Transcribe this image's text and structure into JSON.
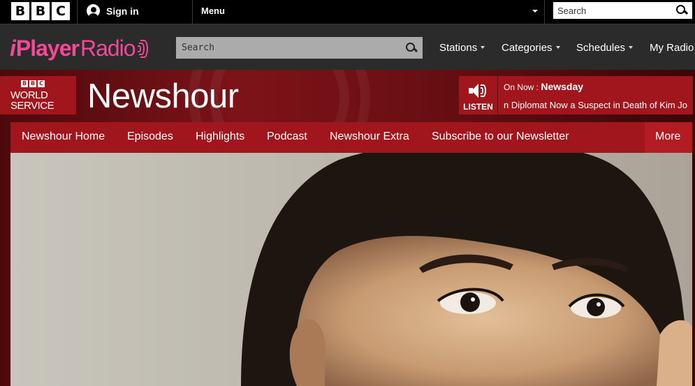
{
  "topbar": {
    "logo": [
      "B",
      "B",
      "C"
    ],
    "sign_in": "Sign in",
    "menu": "Menu",
    "search_placeholder": "Search"
  },
  "radio_bar": {
    "logo_i": "i",
    "logo_player": "Player",
    "logo_radio": "Radio",
    "search_placeholder": "Search",
    "nav": [
      "Stations",
      "Categories",
      "Schedules",
      "My Radio"
    ]
  },
  "brand": {
    "ws_bbc": [
      "B",
      "B",
      "C"
    ],
    "ws_line1": "WORLD",
    "ws_line2": "SERVICE",
    "title": "Newshour",
    "listen": "LISTEN",
    "on_now_prefix": "On Now :",
    "on_now_show": "Newsday",
    "ticker": "n Diplomat Now a Suspect in Death of Kim Jo"
  },
  "subnav": {
    "items": [
      "Newshour Home",
      "Episodes",
      "Highlights",
      "Podcast",
      "Newshour Extra",
      "Subscribe to our Newsletter"
    ],
    "more": "More"
  },
  "colors": {
    "brand_red": "#a0161c",
    "iplayer_pink": "#f54997",
    "topbar_bg": "#000000",
    "radiobar_bg": "#2b2b2b"
  },
  "hero": {
    "image": "portrait-photo"
  }
}
